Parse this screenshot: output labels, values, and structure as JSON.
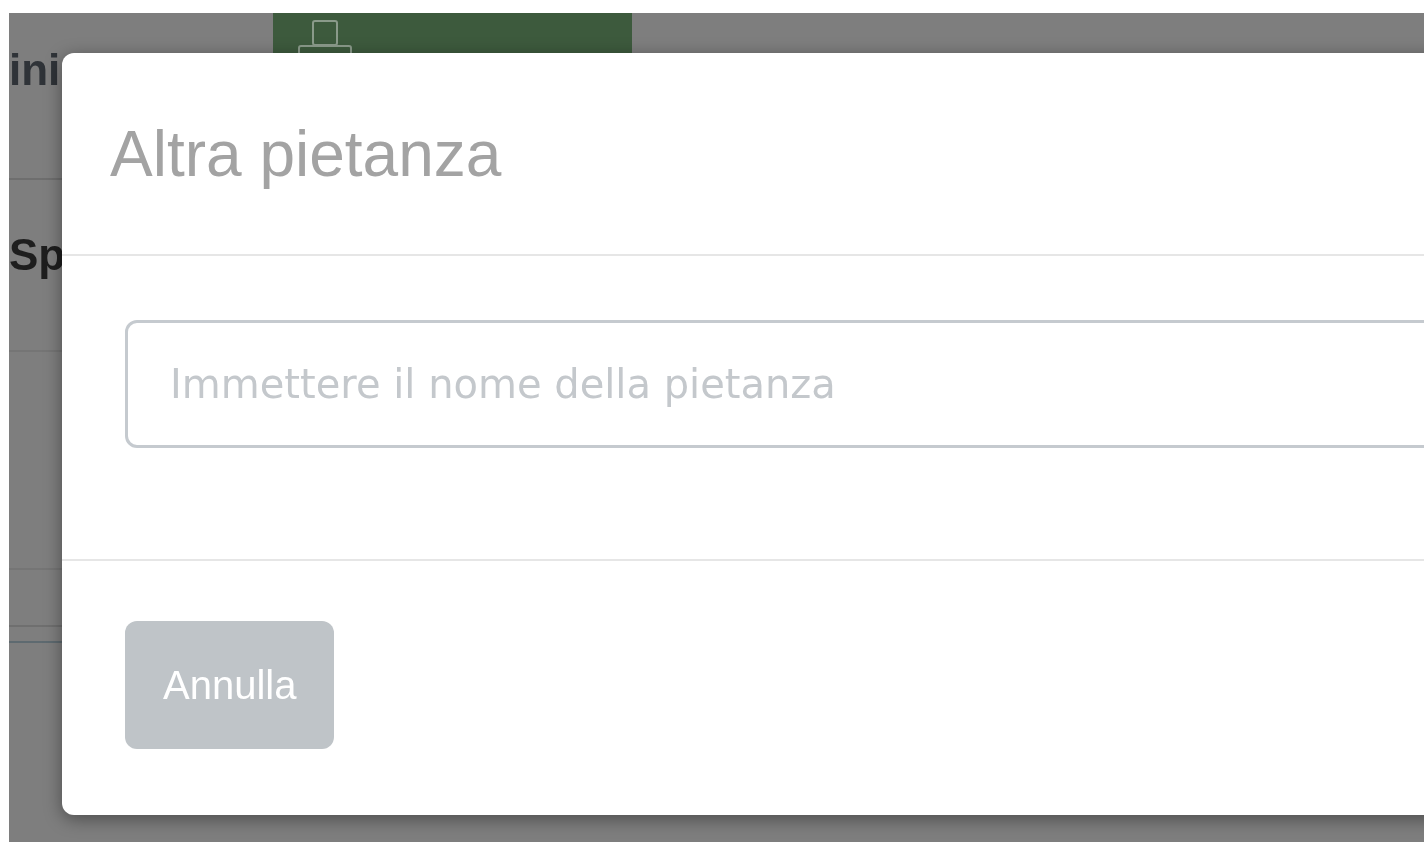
{
  "background": {
    "heading_fragment": "ini",
    "section_fragment": "Sp"
  },
  "modal": {
    "title": "Altra pietanza",
    "input": {
      "placeholder": "Immettere il nome della pietanza"
    },
    "buttons": [
      {
        "label": "Annulla",
        "kind": "secondary"
      }
    ]
  }
}
